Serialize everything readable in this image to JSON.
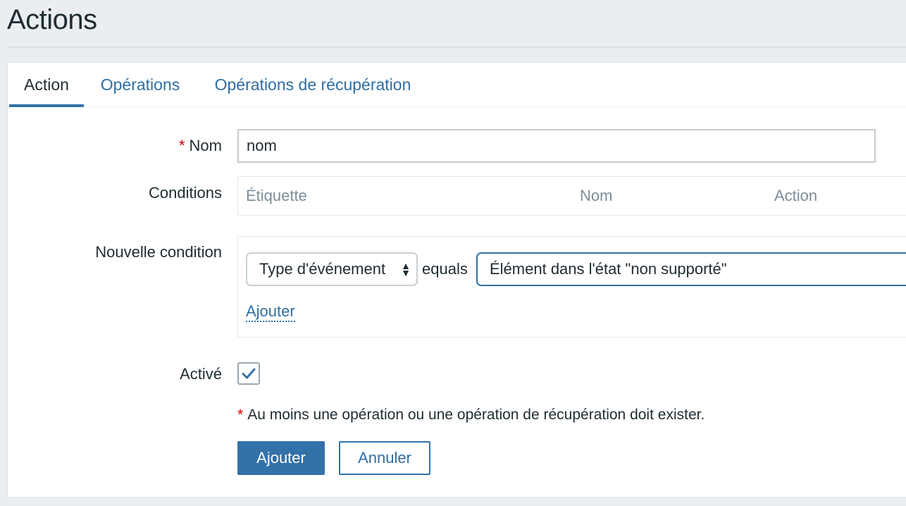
{
  "page": {
    "title": "Actions"
  },
  "tabs": [
    {
      "label": "Action",
      "active": true
    },
    {
      "label": "Opérations",
      "active": false
    },
    {
      "label": "Opérations de récupération",
      "active": false
    }
  ],
  "form": {
    "name_label": "Nom",
    "name_required_mark": "*",
    "name_value": "nom",
    "conditions_label": "Conditions",
    "conditions_columns": [
      "Étiquette",
      "Nom",
      "Action"
    ],
    "new_condition_label": "Nouvelle condition",
    "new_condition": {
      "type_value": "Type d'événement",
      "operator": "equals",
      "value": "Élément dans l'état \"non supporté\"",
      "add_link": "Ajouter"
    },
    "enabled_label": "Activé",
    "enabled_checked": true,
    "note_mark": "*",
    "note_text": "Au moins une opération ou une opération de récupération doit exister."
  },
  "buttons": {
    "submit": "Ajouter",
    "cancel": "Annuler"
  },
  "colors": {
    "accent": "#3371a9",
    "link": "#2f6ea5",
    "required": "#d40000",
    "background": "#ebeef0"
  }
}
